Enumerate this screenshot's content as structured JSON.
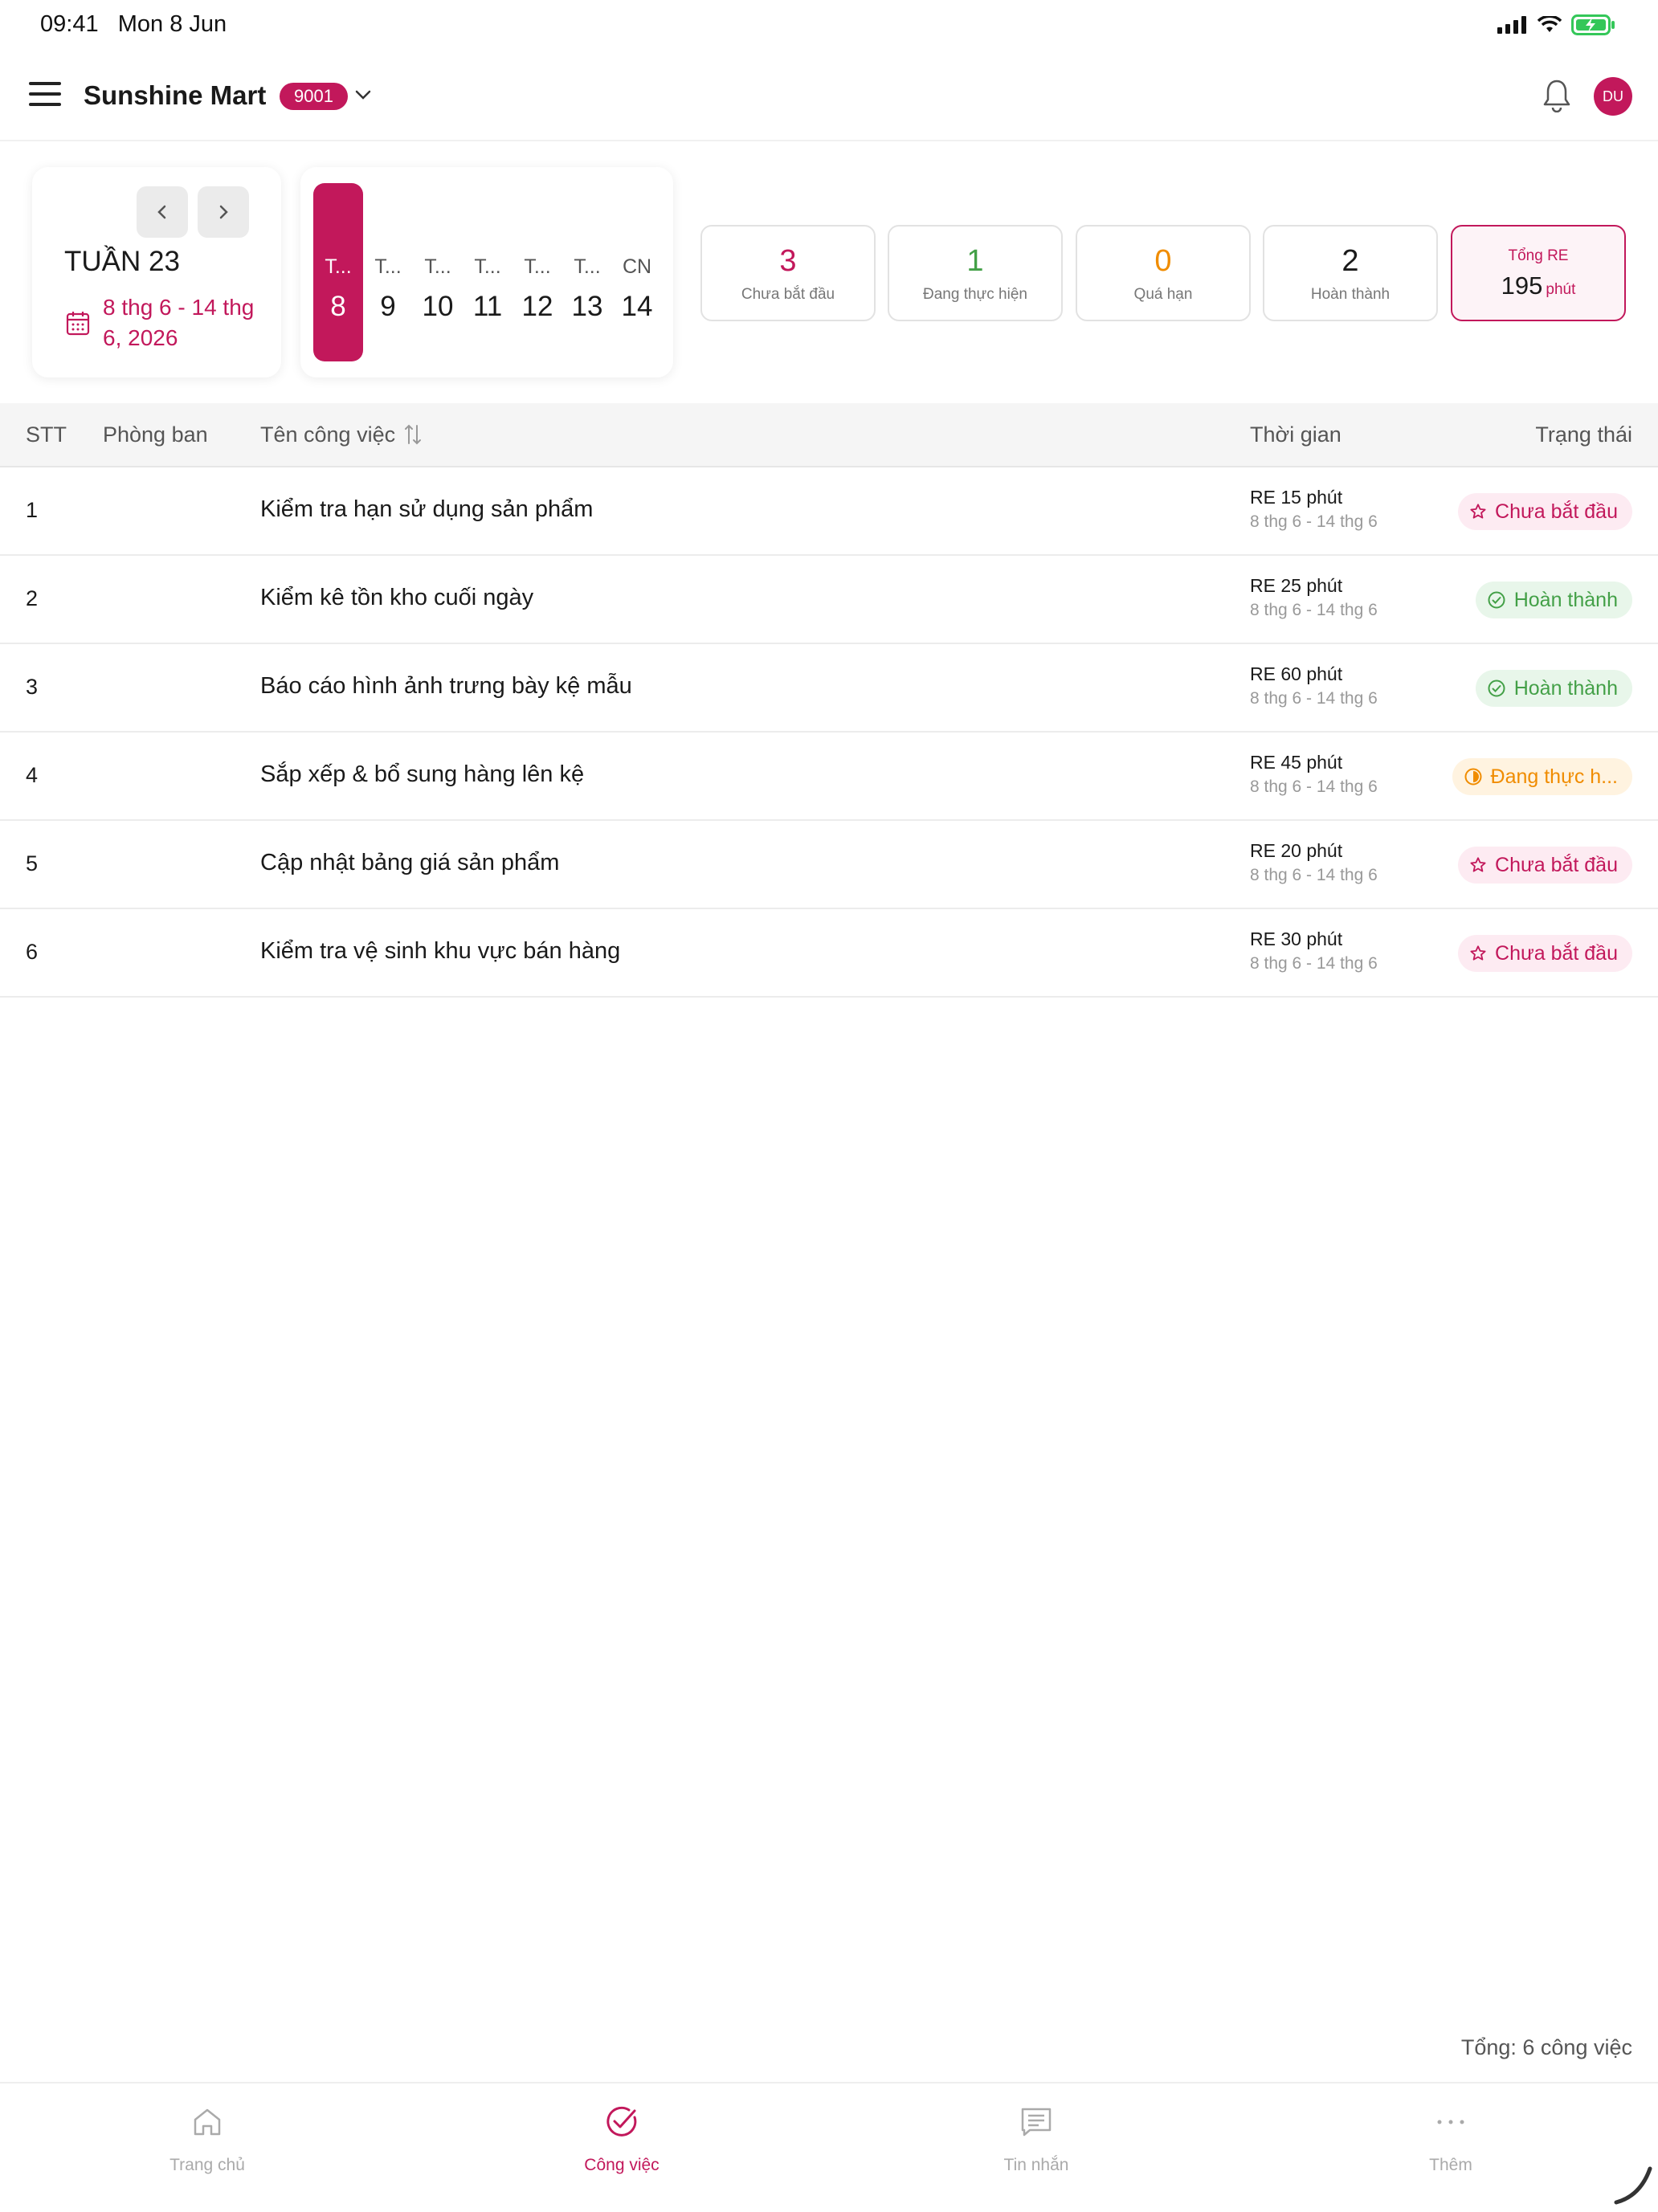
{
  "status_bar": {
    "time": "09:41",
    "date": "Mon 8 Jun"
  },
  "header": {
    "store_name": "Sunshine Mart",
    "store_code": "9001",
    "avatar_initials": "DU"
  },
  "week": {
    "title": "TUẦN 23",
    "range": "8 thg 6 - 14 thg 6, 2026"
  },
  "days": [
    {
      "name": "T...",
      "num": "8",
      "selected": true
    },
    {
      "name": "T...",
      "num": "9"
    },
    {
      "name": "T...",
      "num": "10"
    },
    {
      "name": "T...",
      "num": "11"
    },
    {
      "name": "T...",
      "num": "12"
    },
    {
      "name": "T...",
      "num": "13"
    },
    {
      "name": "CN",
      "num": "14"
    }
  ],
  "stats": {
    "not_started": {
      "value": "3",
      "label": "Chưa bắt đầu",
      "color": "#c2185b"
    },
    "in_progress": {
      "value": "1",
      "label": "Đang thực hiện",
      "color": "#43a047"
    },
    "overdue": {
      "value": "0",
      "label": "Quá hạn",
      "color": "#f08c00"
    },
    "done": {
      "value": "2",
      "label": "Hoàn thành",
      "color": "#1a1a1a"
    },
    "total_re": {
      "label": "Tổng RE",
      "value": "195",
      "unit": "phút"
    }
  },
  "table": {
    "headers": {
      "stt": "STT",
      "department": "Phòng ban",
      "task": "Tên công việc",
      "time": "Thời gian",
      "status": "Trạng thái"
    },
    "rows": [
      {
        "stt": "1",
        "department": "",
        "task": "Kiểm tra hạn sử dụng sản phẩm",
        "re": "RE 15 phút",
        "range": "8 thg 6 - 14 thg 6",
        "status": "Chưa bắt đầu",
        "status_type": "todo"
      },
      {
        "stt": "2",
        "department": "",
        "task": "Kiểm kê tồn kho cuối ngày",
        "re": "RE 25 phút",
        "range": "8 thg 6 - 14 thg 6",
        "status": "Hoàn thành",
        "status_type": "done"
      },
      {
        "stt": "3",
        "department": "",
        "task": "Báo cáo hình ảnh trưng bày kệ mẫu",
        "re": "RE 60 phút",
        "range": "8 thg 6 - 14 thg 6",
        "status": "Hoàn thành",
        "status_type": "done"
      },
      {
        "stt": "4",
        "department": "",
        "task": "Sắp xếp & bổ sung hàng lên kệ",
        "re": "RE 45 phút",
        "range": "8 thg 6 - 14 thg 6",
        "status": "Đang thực h...",
        "status_type": "doing"
      },
      {
        "stt": "5",
        "department": "",
        "task": "Cập nhật bảng giá sản phẩm",
        "re": "RE 20 phút",
        "range": "8 thg 6 - 14 thg 6",
        "status": "Chưa bắt đầu",
        "status_type": "todo"
      },
      {
        "stt": "6",
        "department": "",
        "task": "Kiểm tra vệ sinh khu vực bán hàng",
        "re": "RE 30 phút",
        "range": "8 thg 6 - 14 thg 6",
        "status": "Chưa bắt đầu",
        "status_type": "todo"
      }
    ]
  },
  "footer": {
    "total": "Tổng: 6 công việc"
  },
  "bottom_nav": [
    {
      "label": "Trang chủ",
      "icon": "home-icon"
    },
    {
      "label": "Công việc",
      "icon": "check-circle-icon",
      "active": true
    },
    {
      "label": "Tin nhắn",
      "icon": "message-icon"
    },
    {
      "label": "Thêm",
      "icon": "more-icon"
    }
  ],
  "colors": {
    "accent": "#c2185b",
    "success": "#43a047",
    "warning": "#f08c00"
  }
}
